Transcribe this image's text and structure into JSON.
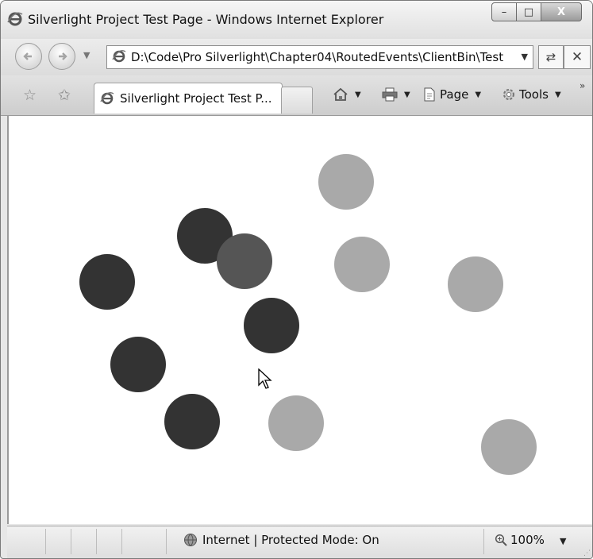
{
  "window": {
    "title": "Silverlight Project Test Page - Windows Internet Explorer",
    "buttons": {
      "minimize": "–",
      "maximize": "□",
      "close": "X"
    }
  },
  "nav": {
    "address": "D:\\Code\\Pro Silverlight\\Chapter04\\RoutedEvents\\ClientBin\\Test",
    "dropdown_glyph": "▼",
    "refresh_glyph": "⇄",
    "stop_glyph": "✕"
  },
  "tabbar": {
    "tab_label": "Silverlight Project Test P...",
    "commands": {
      "page": "Page",
      "tools": "Tools"
    },
    "more_glyph": "»"
  },
  "canvas": {
    "colors": {
      "dark": "#333333",
      "medium": "#555555",
      "light": "#a9a9a9"
    },
    "circles": [
      {
        "shade": "light"
      },
      {
        "shade": "dark"
      },
      {
        "shade": "medium"
      },
      {
        "shade": "light"
      },
      {
        "shade": "light"
      },
      {
        "shade": "dark"
      },
      {
        "shade": "dark"
      },
      {
        "shade": "dark"
      },
      {
        "shade": "dark"
      },
      {
        "shade": "light"
      },
      {
        "shade": "light"
      }
    ]
  },
  "statusbar": {
    "zone": "Internet | Protected Mode: On",
    "zoom": "100%",
    "zoom_dropdown": "▼"
  }
}
